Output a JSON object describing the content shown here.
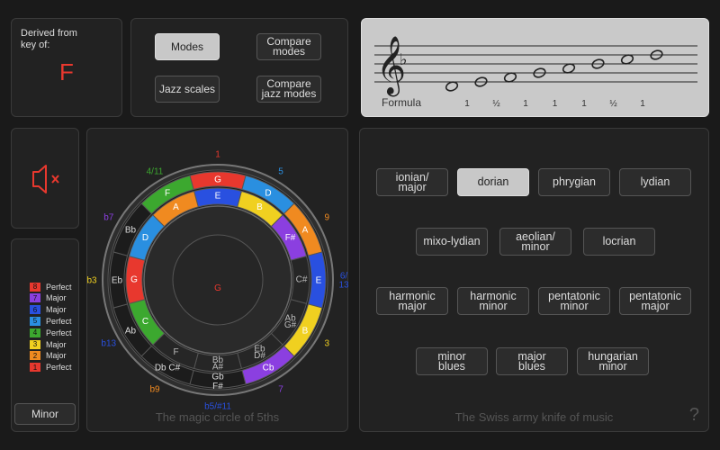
{
  "key_panel": {
    "label_line1": "Derived from",
    "label_line2": "key of:",
    "key": "F"
  },
  "view_buttons": [
    {
      "label": "Modes",
      "active": true
    },
    {
      "label": "Compare modes",
      "active": false
    },
    {
      "label": "Jazz scales",
      "active": false
    },
    {
      "label": "Compare jazz modes",
      "active": false
    }
  ],
  "staff": {
    "clef_icon": "treble-clef-icon",
    "key_signature": "♭",
    "formula_label": "Formula",
    "formula": [
      "1",
      "½",
      "1",
      "1",
      "1",
      "½",
      "1"
    ]
  },
  "mute_icon": "speaker-muted-icon",
  "legend": [
    {
      "num": "8",
      "label": "Perfect",
      "color": "#e8382e"
    },
    {
      "num": "7",
      "label": "Major",
      "color": "#8b3fe0"
    },
    {
      "num": "6",
      "label": "Major",
      "color": "#2950e0"
    },
    {
      "num": "5",
      "label": "Perfect",
      "color": "#2a8fe0"
    },
    {
      "num": "4",
      "label": "Perfect",
      "color": "#3ca82f"
    },
    {
      "num": "3",
      "label": "Major",
      "color": "#f0d020"
    },
    {
      "num": "2",
      "label": "Major",
      "color": "#f08a20"
    },
    {
      "num": "1",
      "label": "Perfect",
      "color": "#e8382e"
    }
  ],
  "scale_type_button": "Minor",
  "circle": {
    "center_note": "G",
    "footer": "The magic circle of 5ths",
    "outer_notes": [
      "G",
      "D",
      "A",
      "E",
      "B",
      "F#",
      "C#",
      "Ab",
      "Eb",
      "Bb",
      "F",
      "C"
    ],
    "outer_display": [
      "G",
      "D",
      "A",
      "E",
      "B",
      "Cb",
      "Gb\nF#",
      "Db C#",
      "Ab",
      "Eb",
      "Bb",
      "F",
      "C"
    ],
    "inner_notes": [
      "E",
      "B",
      "F#",
      "C#",
      "G#",
      "D#",
      "A#",
      "F",
      "C",
      "G",
      "D",
      "A"
    ],
    "inner_display": [
      "E",
      "B",
      "F#",
      "C#",
      "Ab\nG#",
      "Eb\nD#",
      "Bb\nA#",
      "F",
      "C",
      "G",
      "D",
      "A"
    ],
    "interval_labels": [
      "1",
      "5",
      "9",
      "6/\n13",
      "3",
      "7",
      "b5/#11",
      "b9",
      "b13",
      "b3",
      "b7",
      "4/11"
    ],
    "colors": {
      "G": "#e8382e",
      "D": "#2a8fe0",
      "C": "#3ca82f",
      "A": "#f08a20",
      "E": "#2950e0",
      "B": "#f0d020",
      "F#": "#8b3fe0"
    },
    "label_colors": [
      "#e8382e",
      "#2a8fe0",
      "#f08a20",
      "#2950e0",
      "#f0d020",
      "#8b3fe0",
      "#2950e0",
      "#f08a20",
      "#2950e0",
      "#f0d020",
      "#8b3fe0",
      "#3ca82f"
    ]
  },
  "modes": {
    "footer": "The Swiss army knife of music",
    "help_icon": "?",
    "items": [
      {
        "label": "ionian/\nmajor",
        "active": false
      },
      {
        "label": "dorian",
        "active": true
      },
      {
        "label": "phrygian",
        "active": false
      },
      {
        "label": "lydian",
        "active": false
      },
      {
        "label": "mixo-lydian",
        "active": false
      },
      {
        "label": "aeolian/\nminor",
        "active": false
      },
      {
        "label": "locrian",
        "active": false
      },
      {
        "label": "harmonic\nmajor",
        "active": false
      },
      {
        "label": "harmonic\nminor",
        "active": false
      },
      {
        "label": "pentatonic\nminor",
        "active": false
      },
      {
        "label": "pentatonic\nmajor",
        "active": false
      },
      {
        "label": "minor\nblues",
        "active": false
      },
      {
        "label": "major\nblues",
        "active": false
      },
      {
        "label": "hungarian\nminor",
        "active": false
      }
    ]
  }
}
